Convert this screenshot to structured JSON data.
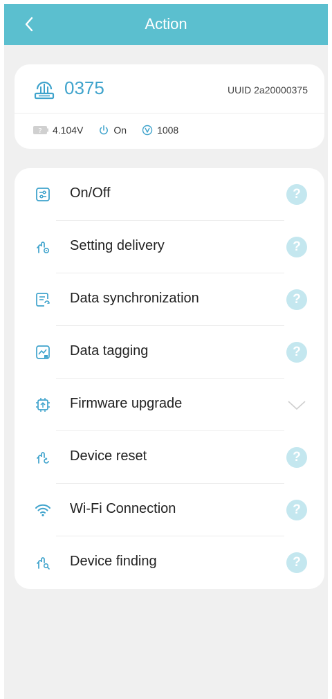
{
  "header": {
    "title": "Action",
    "background_color": "#5bbfcf"
  },
  "device": {
    "id": "0375",
    "uuid": "UUID 2a20000375",
    "battery": "4.104V",
    "power": "On",
    "version": "1008",
    "accent_color": "#3fa3cc"
  },
  "menu": {
    "items": [
      {
        "label": "On/Off",
        "icon": "toggle-panel-icon",
        "trailing": "help-icon"
      },
      {
        "label": "Setting delivery",
        "icon": "hand-gear-icon",
        "trailing": "help-icon"
      },
      {
        "label": "Data synchronization",
        "icon": "document-sync-icon",
        "trailing": "help-icon"
      },
      {
        "label": "Data tagging",
        "icon": "chart-tag-icon",
        "trailing": "help-icon"
      },
      {
        "label": "Firmware upgrade",
        "icon": "chip-upgrade-icon",
        "trailing": "chevron-down-icon"
      },
      {
        "label": "Device reset",
        "icon": "hand-reset-icon",
        "trailing": "help-icon"
      },
      {
        "label": "Wi-Fi Connection",
        "icon": "wifi-icon",
        "trailing": "help-icon"
      },
      {
        "label": "Device finding",
        "icon": "hand-search-icon",
        "trailing": "help-icon"
      }
    ],
    "help_glyph": "?"
  }
}
